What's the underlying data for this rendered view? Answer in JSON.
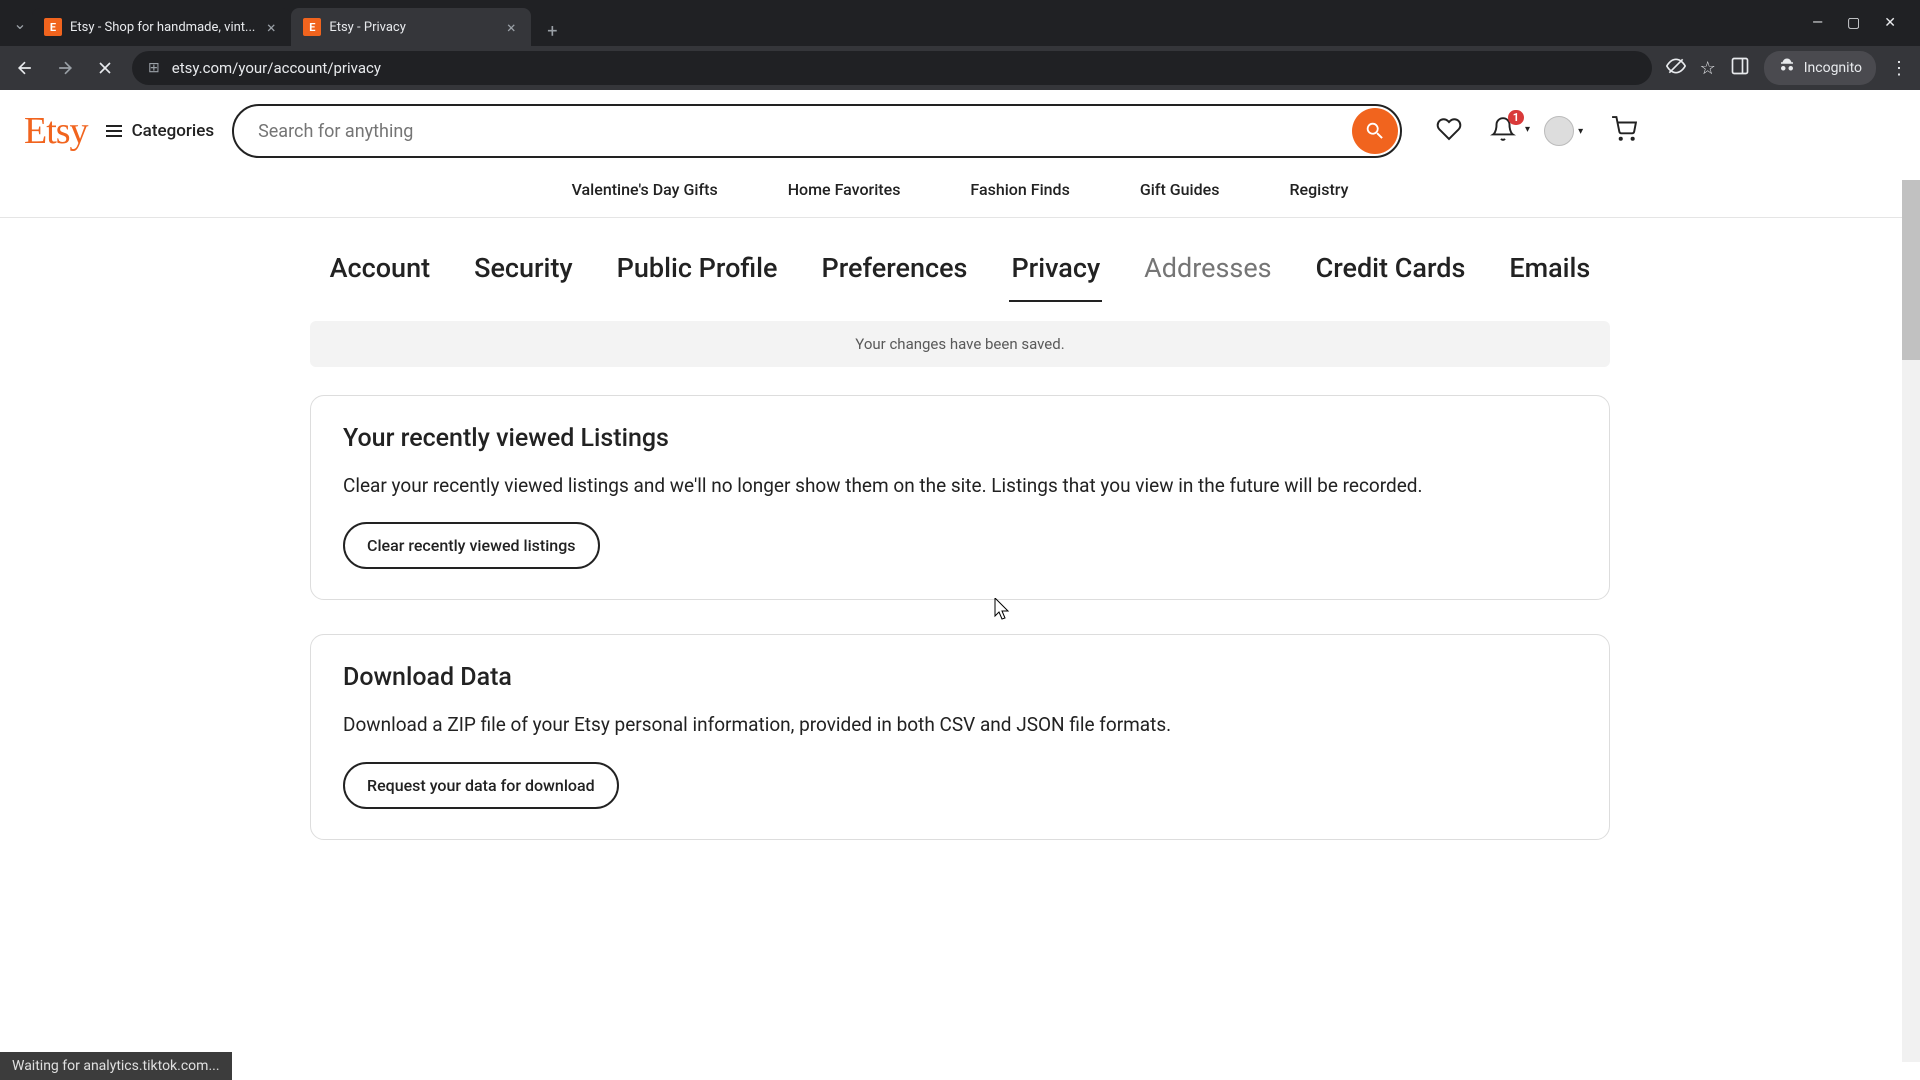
{
  "browser": {
    "tabs": [
      {
        "title": "Etsy - Shop for handmade, vint..."
      },
      {
        "title": "Etsy - Privacy"
      }
    ],
    "url": "etsy.com/your/account/privacy",
    "incognito_label": "Incognito"
  },
  "header": {
    "logo_text": "Etsy",
    "categories_label": "Categories",
    "search_placeholder": "Search for anything",
    "notification_count": "1"
  },
  "nav": {
    "items": [
      "Valentine's Day Gifts",
      "Home Favorites",
      "Fashion Finds",
      "Gift Guides",
      "Registry"
    ]
  },
  "account_tabs": {
    "items": [
      "Account",
      "Security",
      "Public Profile",
      "Preferences",
      "Privacy",
      "Addresses",
      "Credit Cards",
      "Emails"
    ],
    "active_index": 4
  },
  "notice": "Your changes have been saved.",
  "cards": {
    "recently_viewed": {
      "title": "Your recently viewed Listings",
      "desc": "Clear your recently viewed listings and we'll no longer show them on the site. Listings that you view in the future will be recorded.",
      "button": "Clear recently viewed listings"
    },
    "download_data": {
      "title": "Download Data",
      "desc": "Download a ZIP file of your Etsy personal information, provided in both CSV and JSON file formats.",
      "button": "Request your data for download"
    }
  },
  "status_bar": "Waiting for analytics.tiktok.com..."
}
